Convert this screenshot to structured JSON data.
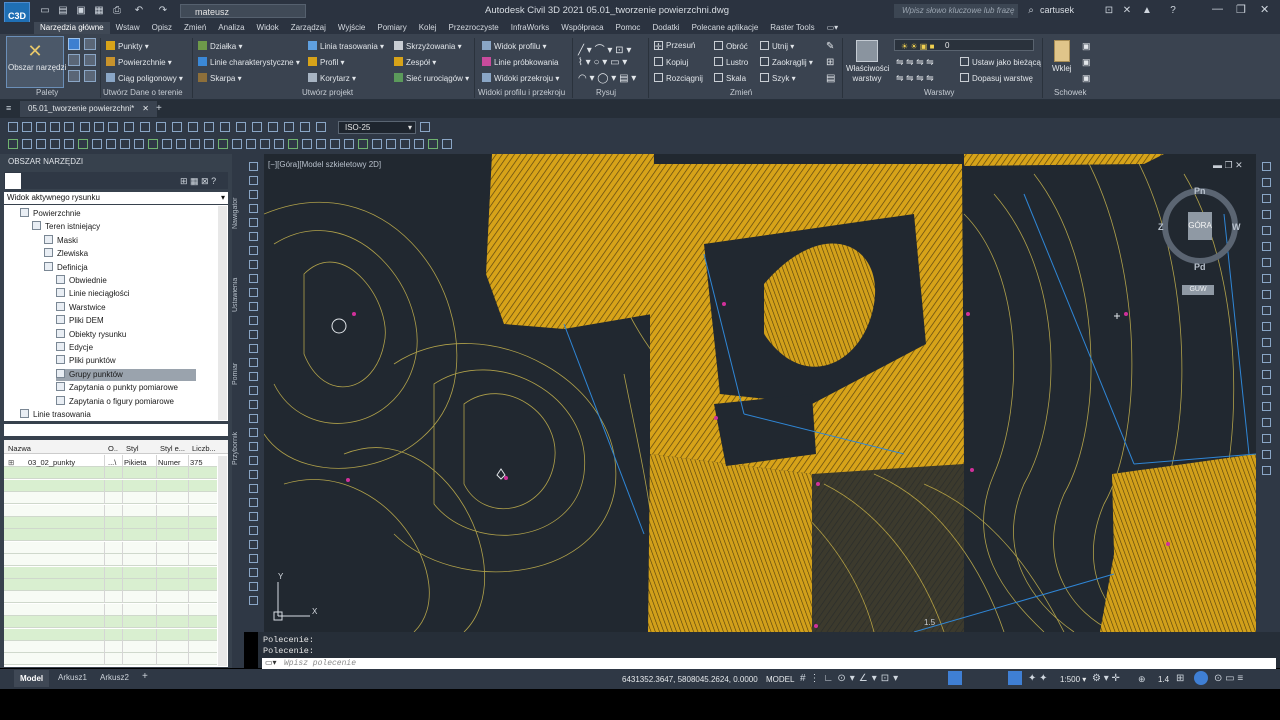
{
  "app": {
    "logo_text": "C3D",
    "window_title": "Autodesk Civil 3D 2021   05.01_tworzenie powierzchni.dwg",
    "workspace": "mateusz",
    "search_placeholder": "Wpisz słowo kluczowe lub frazę",
    "user": "cartusek"
  },
  "ribbon_tabs": [
    "Narzędzia główne",
    "Wstaw",
    "Opisz",
    "Zmień",
    "Analiza",
    "Widok",
    "Zarządzaj",
    "Wyjście",
    "Pomiary",
    "Kolej",
    "Przezroczyste",
    "InfraWorks",
    "Współpraca",
    "Pomoc",
    "Dodatki",
    "Polecane aplikacje",
    "Raster Tools"
  ],
  "ribbon": {
    "tools_button": "Obszar narzędzi",
    "palettes_label": "Palety",
    "ground_data": {
      "label": "Utwórz Dane o terenie",
      "items": [
        "Punkty",
        "Powierzchnie",
        "Ciąg poligonowy"
      ]
    },
    "design": {
      "label": "Utwórz projekt",
      "col1": [
        "Działka",
        "Linie charakterystyczne",
        "Skarpa"
      ],
      "col2": [
        "Linia trasowania",
        "Profil",
        "Korytarz"
      ],
      "col3": [
        "Skrzyżowania",
        "Zespół",
        "Sieć rurociągów"
      ]
    },
    "profile": {
      "label": "Widoki profilu i przekroju",
      "items": [
        "Widok profilu",
        "Linie próbkowania",
        "Widoki przekroju"
      ]
    },
    "draw": {
      "label": "Rysuj"
    },
    "modify": {
      "label": "Zmień",
      "col1": [
        "Przesuń",
        "Kopiuj",
        "Rozciągnij"
      ],
      "col2": [
        "Obróć",
        "Lustro",
        "Skala"
      ],
      "col3": [
        "Utnij",
        "Zaokrąglij",
        "Szyk"
      ]
    },
    "properties": {
      "label": "Właściwości warstwy"
    },
    "layers": {
      "label": "Warstwy",
      "current_layer": "0",
      "set_current": "Ustaw jako bieżącą",
      "match_layer": "Dopasuj warstwę"
    },
    "clipboard": {
      "label": "Schowek",
      "paste": "Wklej"
    }
  },
  "doc_tab": "05.01_tworzenie powierzchni*",
  "toolbar": {
    "dimstyle": "ISO-25"
  },
  "toolspace": {
    "title": "OBSZAR NARZĘDZI",
    "view": "Widok aktywnego rysunku",
    "tree": [
      "Powierzchnie",
      "Teren istniejący",
      "Maski",
      "Zlewiska",
      "Definicja",
      "Obwiednie",
      "Linie nieciągłości",
      "Warstwice",
      "Pliki DEM",
      "Obiekty rysunku",
      "Edycje",
      "Pliki punktów",
      "Grupy punktów",
      "Zapytania o punkty pomiarowe",
      "Zapytania o figury pomiarowe",
      "Linie trasowania"
    ],
    "side_tabs": [
      "Nawigator",
      "Ustawienia",
      "Pomiar",
      "Przybornik"
    ],
    "table": {
      "headers": [
        "Nazwa",
        "O..",
        "Styl",
        "Styl e...",
        "Liczb..."
      ],
      "rows": [
        [
          "03_02_punkty",
          "...\\",
          "Pikieta",
          "Numer",
          "375"
        ]
      ]
    }
  },
  "viewport": {
    "label": "[−][Góra][Model szkieletowy 2D]",
    "viewcube": {
      "top": "GÓRA",
      "n": "Pn",
      "s": "Pd",
      "e": "W",
      "w": "Z",
      "wcs": "GUW"
    },
    "axis_x": "X",
    "axis_y": "Y",
    "annotation": "1.5"
  },
  "command": {
    "line1": "Polecenie:",
    "line2": "Polecenie:",
    "placeholder": "Wpisz polecenie"
  },
  "status": {
    "tabs": [
      "Model",
      "Arkusz1",
      "Arkusz2"
    ],
    "coords": "6431352.3647, 5808045.2624, 0.0000",
    "mode": "MODEL",
    "scale": "1:500",
    "annoscale": "1.4"
  },
  "colors": {
    "surface": "#d7a319",
    "contour": "#b0a14a",
    "alignment": "#2f86d6",
    "points": "#d0309a",
    "background": "#212830"
  }
}
